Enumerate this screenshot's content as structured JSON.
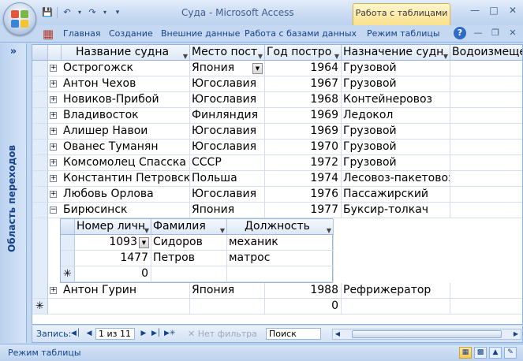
{
  "window": {
    "title": "Суда - Microsoft Access",
    "context_tab": "Работа с таблицами"
  },
  "ribbon": {
    "tabs": [
      "Главная",
      "Создание",
      "Внешние данные",
      "Работа с базами данных",
      "Режим таблицы"
    ],
    "help": "?"
  },
  "nav_pane": {
    "chevron": "»",
    "label": "Область переходов"
  },
  "table": {
    "columns": [
      "Название судна",
      "Место пост",
      "Год постро",
      "Назначение судн",
      "Водоизмещение"
    ],
    "rows": [
      {
        "name": "Острогожск",
        "place": "Япония",
        "year": "1964",
        "purpose": "Грузовой"
      },
      {
        "name": "Антон Чехов",
        "place": "Югославия",
        "year": "1967",
        "purpose": "Грузовой"
      },
      {
        "name": "Новиков-Прибой",
        "place": "Югославия",
        "year": "1968",
        "purpose": "Контейнеровоз"
      },
      {
        "name": "Владивосток",
        "place": "Финляндия",
        "year": "1969",
        "purpose": "Ледокол"
      },
      {
        "name": "Алишер Навои",
        "place": "Югославия",
        "year": "1969",
        "purpose": "Грузовой"
      },
      {
        "name": "Ованес Туманян",
        "place": "Югославия",
        "year": "1970",
        "purpose": "Грузовой"
      },
      {
        "name": "Комсомолец Спасска",
        "place": "СССР",
        "year": "1972",
        "purpose": "Грузовой"
      },
      {
        "name": "Константин Петровский",
        "place": "Польша",
        "year": "1974",
        "purpose": "Лесовоз-пакетовоз"
      },
      {
        "name": "Любовь Орлова",
        "place": "Югославия",
        "year": "1976",
        "purpose": "Пассажирский"
      },
      {
        "name": "Бирюсинск",
        "place": "Япония",
        "year": "1977",
        "purpose": "Буксир-толкач"
      },
      {
        "name": "Антон Гурин",
        "place": "Япония",
        "year": "1988",
        "purpose": "Рефрижератор"
      }
    ],
    "new_row_year": "0"
  },
  "subtable": {
    "columns": [
      "Номер личн",
      "Фамилия",
      "Должность"
    ],
    "rows": [
      {
        "id": "1093",
        "surname": "Сидоров",
        "position": "механик"
      },
      {
        "id": "1477",
        "surname": "Петров",
        "position": "матрос"
      }
    ],
    "new_row_id": "0"
  },
  "record_nav": {
    "label": "Запись:",
    "position": "1 из 11",
    "filter": "Нет фильтра",
    "search_placeholder": "Поиск"
  },
  "status_bar": {
    "text": "Режим таблицы"
  }
}
